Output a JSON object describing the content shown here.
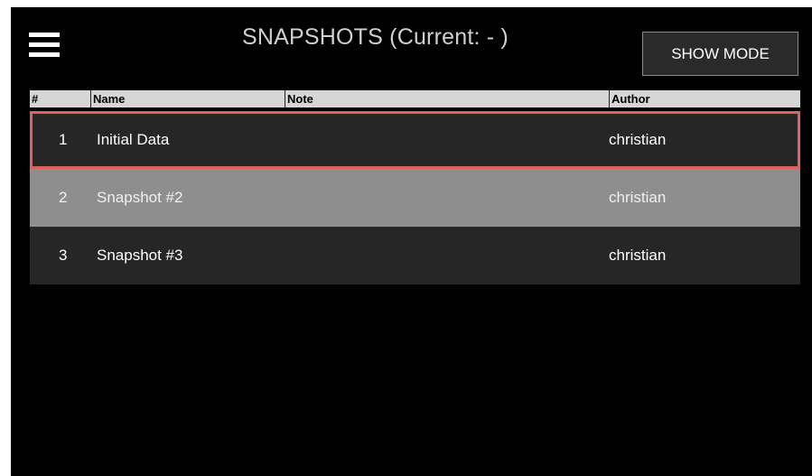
{
  "header": {
    "title": "SNAPSHOTS (Current: - )",
    "show_mode_label": "SHOW MODE"
  },
  "table": {
    "columns": [
      "#",
      "Name",
      "Note",
      "Author"
    ],
    "rows": [
      {
        "num": "1",
        "name": "Initial Data",
        "note": "",
        "author": "christian",
        "selected": true
      },
      {
        "num": "2",
        "name": "Snapshot #2",
        "note": "",
        "author": "christian",
        "selected": false
      },
      {
        "num": "3",
        "name": "Snapshot #3",
        "note": "",
        "author": "christian",
        "selected": false
      }
    ]
  },
  "colors": {
    "selected_outline": "#e0605e",
    "row_dark": "#262626",
    "row_light": "#8e8e8e"
  },
  "icons": {
    "menu": "hamburger-menu-icon"
  }
}
